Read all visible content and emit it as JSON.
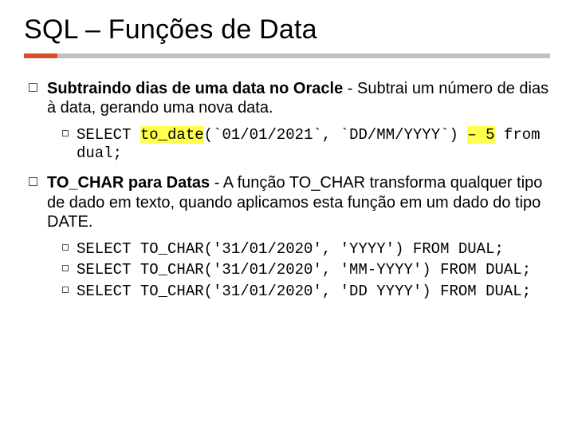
{
  "title": "SQL – Funções de Data",
  "sections": [
    {
      "heading_before": "Subtraindo dias de uma data no Oracle",
      "heading_after": " - Subtrai um número de dias à data, gerando uma nova data.",
      "subs": [
        {
          "prefix": "SELECT ",
          "hl1": "to_date",
          "mid": "(`01/01/2021`, `DD/MM/YYYY`) ",
          "hl2": "– 5",
          "suffix": " from dual;"
        }
      ]
    },
    {
      "heading_before": "TO_CHAR para Datas",
      "heading_after": " - A função TO_CHAR transforma qualquer tipo de dado em texto, quando aplicamos esta função em um dado do tipo DATE.",
      "subs": [
        {
          "line": "SELECT TO_CHAR('31/01/2020', 'YYYY')  FROM DUAL;"
        },
        {
          "line": "SELECT TO_CHAR('31/01/2020', 'MM-YYYY')  FROM DUAL;"
        },
        {
          "line": "SELECT TO_CHAR('31/01/2020', 'DD YYYY')  FROM DUAL;"
        }
      ]
    }
  ]
}
